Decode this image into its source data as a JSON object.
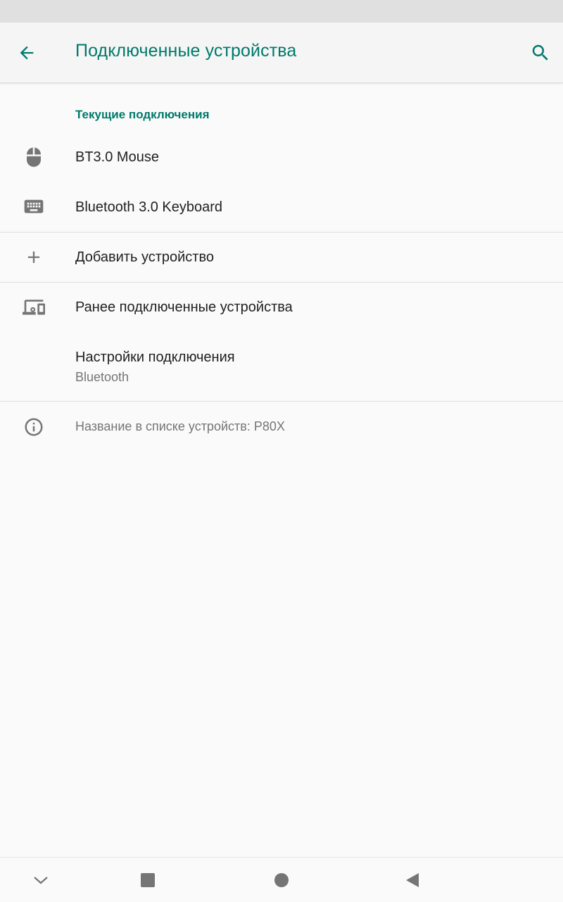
{
  "header": {
    "title": "Подключенные устройства",
    "back_icon": "arrow-back-icon",
    "search_icon": "search-icon"
  },
  "current_connections": {
    "header": "Текущие подключения",
    "devices": [
      {
        "label": "BT3.0 Mouse",
        "icon": "mouse-icon"
      },
      {
        "label": "Bluetooth 3.0 Keyboard",
        "icon": "keyboard-icon"
      }
    ]
  },
  "add_device": {
    "label": "Добавить устройство",
    "icon": "plus-icon"
  },
  "previous_devices": {
    "label": "Ранее подключенные устройства",
    "icon": "devices-icon"
  },
  "connection_prefs": {
    "label": "Настройки подключения",
    "sub": "Bluetooth"
  },
  "device_name_info": {
    "text": "Название в списке устройств: P80X",
    "icon": "info-icon"
  },
  "nav_bar": {
    "icons": [
      "chevron-down-icon",
      "recents-square-icon",
      "home-circle-icon",
      "back-triangle-icon"
    ]
  },
  "colors": {
    "accent": "#00796b",
    "icon_gray": "#757575",
    "text_primary": "#212121",
    "text_secondary": "#757575"
  }
}
